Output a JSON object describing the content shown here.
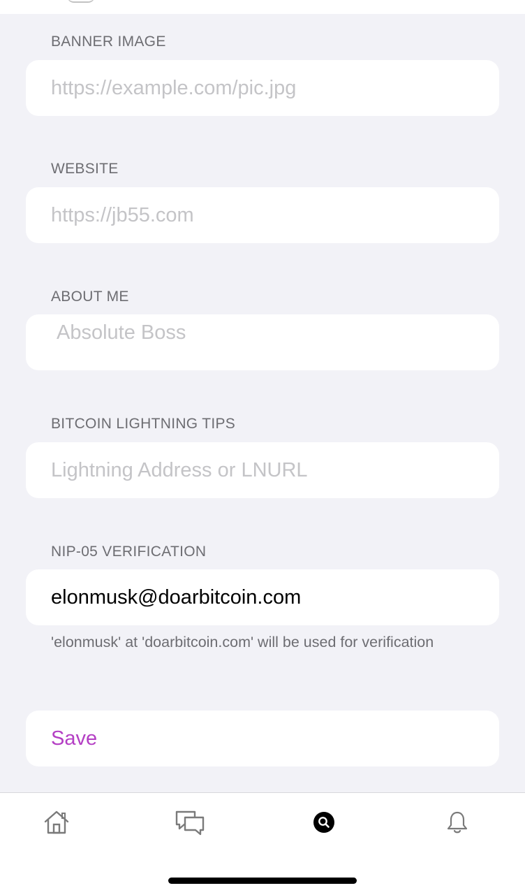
{
  "sections": {
    "banner": {
      "label": "BANNER IMAGE",
      "placeholder": "https://example.com/pic.jpg",
      "value": ""
    },
    "website": {
      "label": "WEBSITE",
      "placeholder": "https://jb55.com",
      "value": ""
    },
    "about": {
      "label": "ABOUT ME",
      "placeholder": "Absolute Boss"
    },
    "lightning": {
      "label": "BITCOIN LIGHTNING TIPS",
      "placeholder": "Lightning Address or LNURL",
      "value": ""
    },
    "nip05": {
      "label": "NIP-05 VERIFICATION",
      "value": "elonmusk@doarbitcoin.com",
      "note": "'elonmusk' at 'doarbitcoin.com' will be used for verification"
    }
  },
  "save_label": "Save",
  "colors": {
    "accent": "#b43fc4",
    "background": "#f2f2f7",
    "label": "#6d6d72"
  },
  "tabbar": {
    "items": [
      {
        "name": "home-icon",
        "active": false
      },
      {
        "name": "chat-bubbles-icon",
        "active": false
      },
      {
        "name": "search-icon",
        "active": true
      },
      {
        "name": "bell-icon",
        "active": false
      }
    ]
  }
}
